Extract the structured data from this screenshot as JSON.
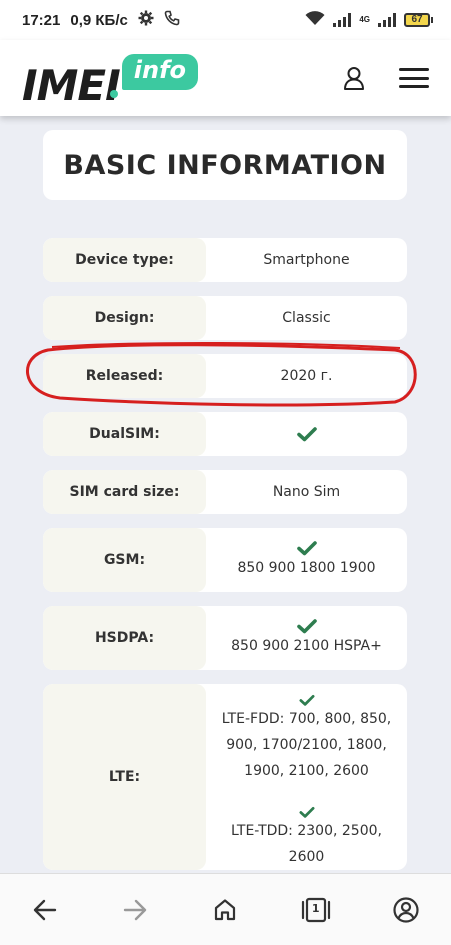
{
  "status_bar": {
    "time": "17:21",
    "speed": "0,9 КБ/с",
    "network_tag": "4G",
    "battery_level": "67"
  },
  "header": {
    "logo_main": "IMEI",
    "logo_badge": "info"
  },
  "title": "BASIC INFORMATION",
  "rows": [
    {
      "label": "Device type:",
      "value": "Smartphone"
    },
    {
      "label": "Design:",
      "value": "Classic"
    },
    {
      "label": "Released:",
      "value": "2020 г."
    },
    {
      "label": "DualSIM:",
      "value": ""
    },
    {
      "label": "SIM card size:",
      "value": "Nano Sim"
    },
    {
      "label": "GSM:",
      "value": "850 900 1800 1900"
    },
    {
      "label": "HSDPA:",
      "value": "850 900 2100 HSPA+"
    },
    {
      "label": "LTE:",
      "value_fdd_1": "LTE-FDD: 700, 800, 850,",
      "value_fdd_2": "900, 1700/2100, 1800,",
      "value_fdd_3": "1900, 2100, 2600",
      "value_tdd": "LTE-TDD: 2300, 2500, 2600"
    }
  ],
  "colors": {
    "accent": "#3cc9a0",
    "check": "#2e7d4f",
    "annotation": "#d61f1f",
    "background": "#eceef4"
  },
  "icons": {
    "settings": "gear-icon",
    "call": "phone-icon",
    "wifi": "wifi-icon",
    "user": "user-icon",
    "menu": "hamburger-icon",
    "back": "arrow-left-icon",
    "forward": "arrow-right-icon",
    "home": "home-icon",
    "tabs": "tabs-icon",
    "account": "account-icon"
  },
  "bottom_nav": {
    "tabs_count": "1"
  }
}
